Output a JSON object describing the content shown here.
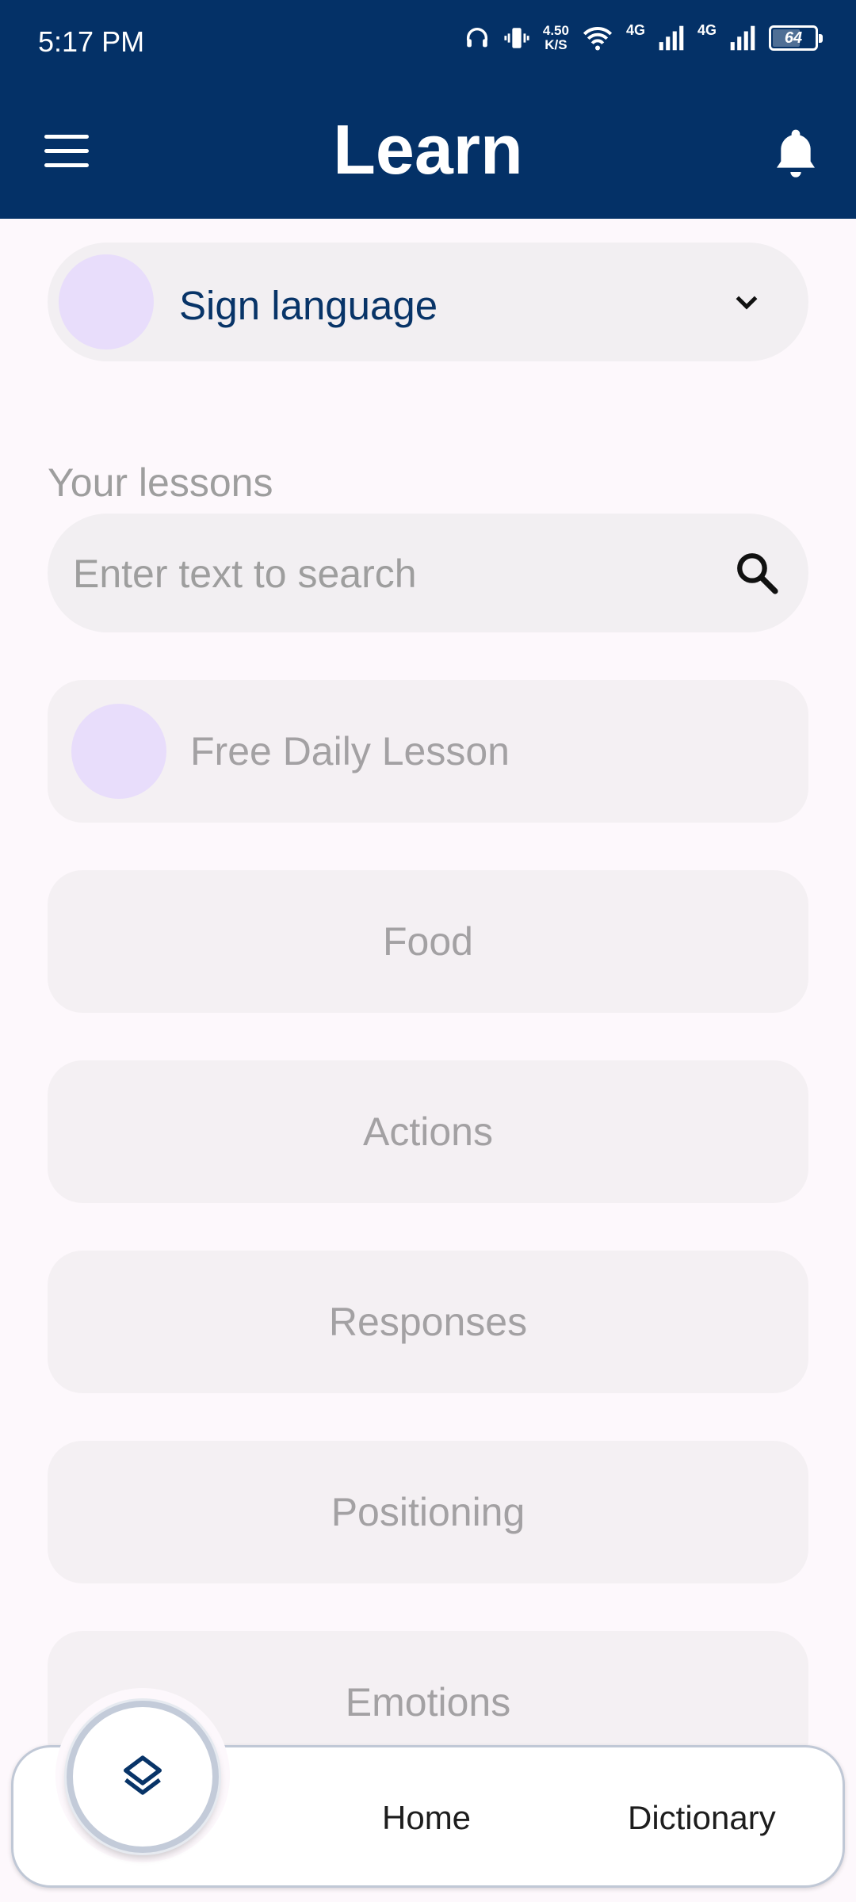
{
  "status_bar": {
    "time": "5:17 PM",
    "net_speed_value": "4.50",
    "net_speed_unit": "K/S",
    "signal_1": "4G",
    "signal_2": "4G",
    "battery_level": "64"
  },
  "app_bar": {
    "title": "Learn",
    "menu_icon": "hamburger-menu-icon",
    "notification_icon": "bell-icon"
  },
  "language_selector": {
    "selected": "Sign language",
    "icon": "chevron-down-icon"
  },
  "lessons_section": {
    "label": "Your lessons",
    "search_placeholder": "Enter text to search",
    "search_value": "",
    "items": [
      {
        "label": "Free Daily Lesson"
      },
      {
        "label": "Food"
      },
      {
        "label": "Actions"
      },
      {
        "label": "Responses"
      },
      {
        "label": "Positioning"
      },
      {
        "label": "Emotions"
      }
    ]
  },
  "bottom_nav": {
    "fab_icon": "layers-icon",
    "items": [
      {
        "label": "Home"
      },
      {
        "label": "Dictionary"
      }
    ]
  },
  "colors": {
    "primary": "#043167",
    "background": "#fdf8fc",
    "card": "#f4f0f3",
    "avatar_placeholder": "#e8ddfb"
  }
}
